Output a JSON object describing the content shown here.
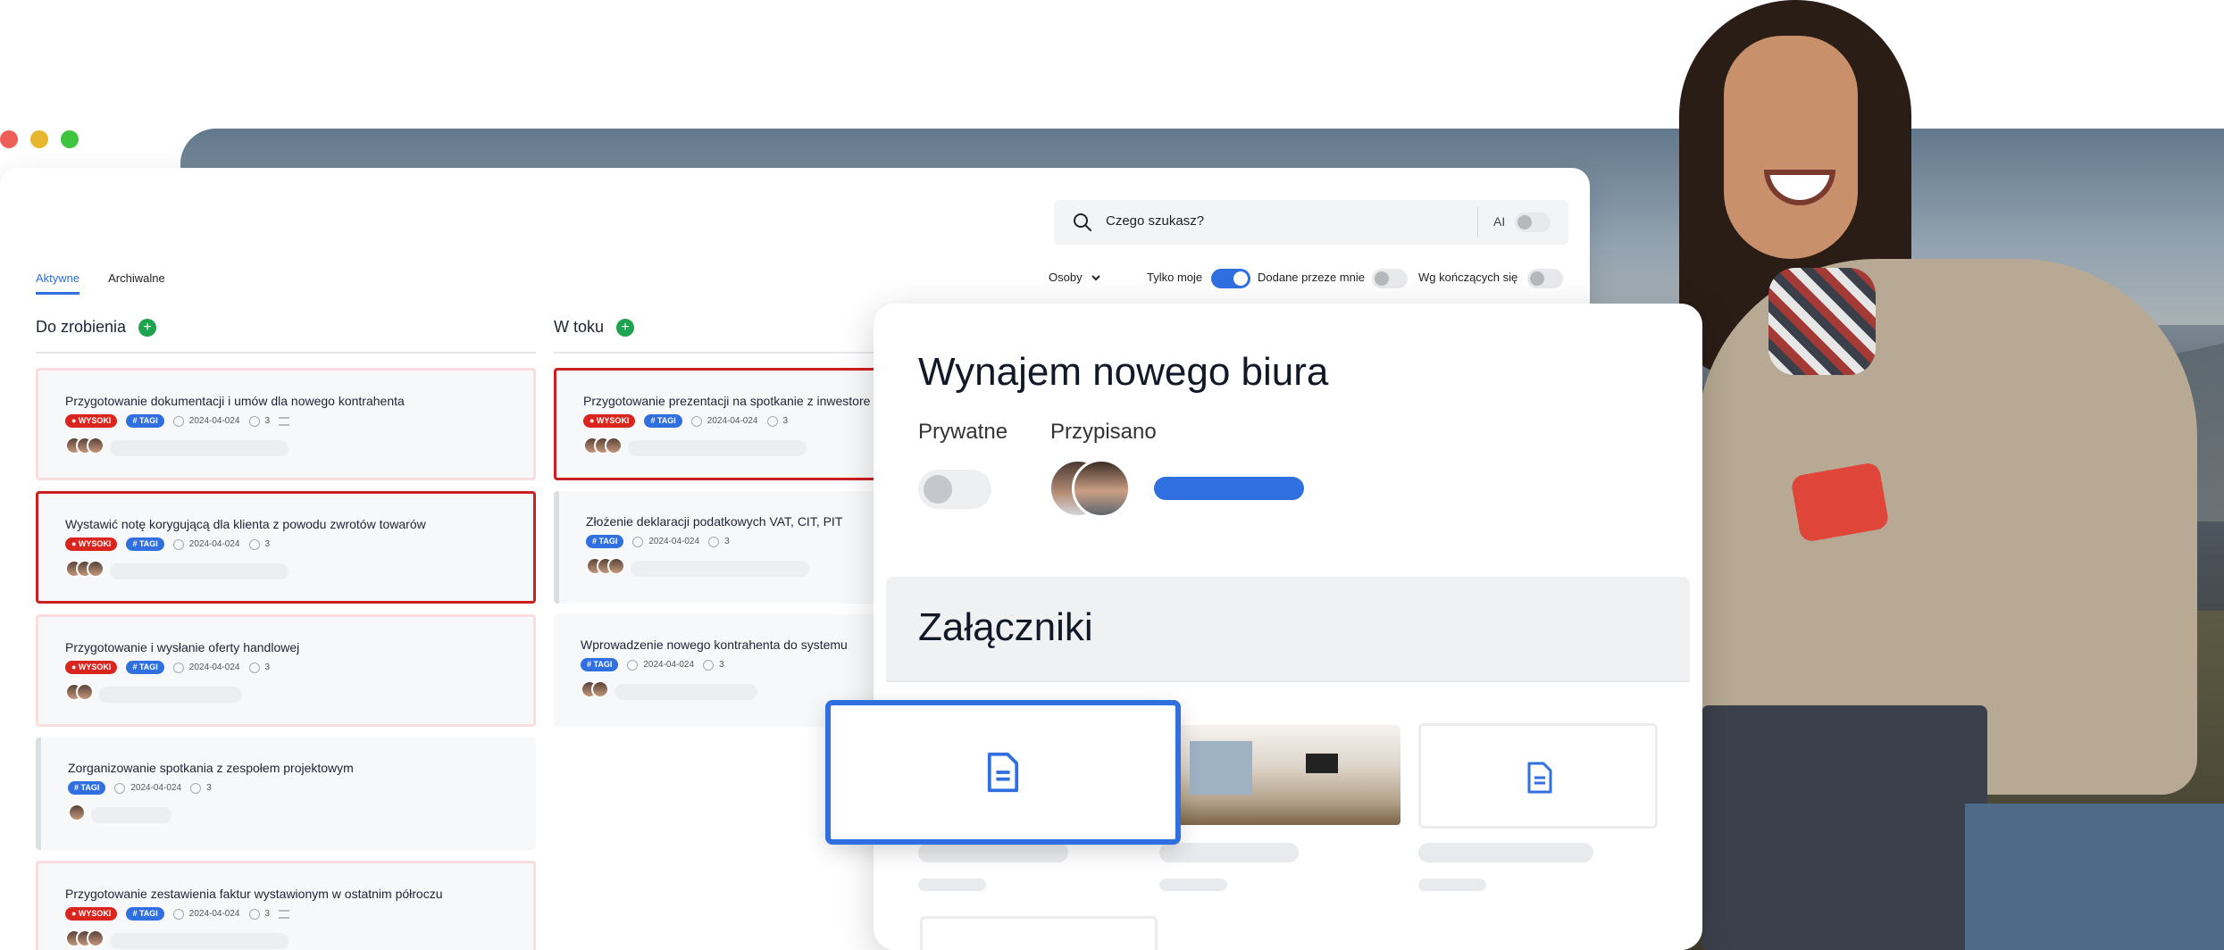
{
  "window_controls": {
    "colors": [
      "#ed5f57",
      "#e8b52e",
      "#3ec43f"
    ]
  },
  "search": {
    "placeholder": "Czego szukasz?",
    "ai_label": "AI",
    "ai_toggle_on": false
  },
  "tabs": [
    {
      "label": "Aktywne",
      "active": true
    },
    {
      "label": "Archiwalne",
      "active": false
    }
  ],
  "filters": {
    "people_label": "Osoby",
    "only_mine": {
      "label": "Tylko moje",
      "on": true
    },
    "added_by_me": {
      "label": "Dodane przeze mnie",
      "on": false
    },
    "by_ending": {
      "label": "Wg kończących się",
      "on": false
    }
  },
  "columns": [
    {
      "title": "Do zrobienia",
      "cards": [
        {
          "title": "Przygotowanie dokumentacji i umów dla nowego kontrahenta",
          "priority": "WYSOKI",
          "tag": "# TAGI",
          "date": "2024-04-024",
          "comments": "3"
        },
        {
          "title": "Wystawić notę korygującą dla klienta z powodu zwrotów towarów",
          "priority": "WYSOKI",
          "tag": "# TAGI",
          "date": "2024-04-024",
          "comments": "3"
        },
        {
          "title": "Przygotowanie i wysłanie oferty handlowej",
          "priority": "WYSOKI",
          "tag": "# TAGI",
          "date": "2024-04-024",
          "comments": "3"
        },
        {
          "title": "Zorganizowanie spotkania z zespołem projektowym",
          "priority": "",
          "tag": "# TAGI",
          "date": "2024-04-024",
          "comments": "3"
        },
        {
          "title": "Przygotowanie zestawienia faktur wystawionym w ostatnim półroczu",
          "priority": "WYSOKI",
          "tag": "# TAGI",
          "date": "2024-04-024",
          "comments": "3"
        }
      ]
    },
    {
      "title": "W toku",
      "cards": [
        {
          "title": "Przygotowanie prezentacji na spotkanie z inwestore",
          "priority": "WYSOKI",
          "tag": "# TAGI",
          "date": "2024-04-024",
          "comments": "3"
        },
        {
          "title": "Złożenie deklaracji podatkowych VAT, CIT, PIT",
          "priority": "",
          "tag": "# TAGI",
          "date": "2024-04-024",
          "comments": "3"
        },
        {
          "title": "Wprowadzenie nowego kontrahenta do systemu",
          "priority": "",
          "tag": "# TAGI",
          "date": "2024-04-024",
          "comments": "3"
        }
      ]
    }
  ],
  "detail": {
    "title": "Wynajem nowego biura",
    "private_label": "Prywatne",
    "private_on": false,
    "assigned_label": "Przypisano",
    "attachments_title": "Załączniki"
  },
  "icons": [
    "search-icon",
    "chevron-down-icon",
    "plus-icon",
    "clock-icon",
    "comment-icon",
    "list-icon",
    "document-icon"
  ],
  "accent_color": "#2f6fe0",
  "priority_color": "#d9251d",
  "add_color": "#1ea44f"
}
